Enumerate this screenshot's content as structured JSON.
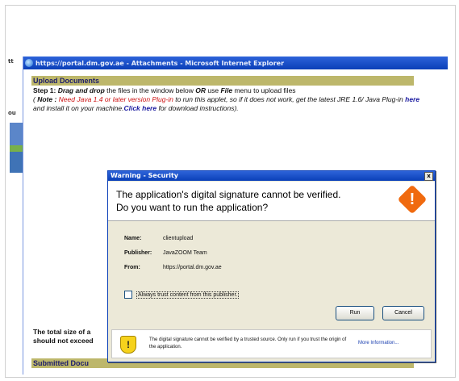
{
  "ie_window": {
    "title": "https://portal.dm.gov.ae - Attachments - Microsoft Internet Explorer"
  },
  "background_window": {
    "tab_fragment_1": "tt",
    "tab_fragment_2": "ou"
  },
  "page": {
    "upload_header": "Upload Documents",
    "step1_label": "Step 1:",
    "step1_drag": "Drag and drop",
    "step1_mid": " the files in the window below ",
    "step1_or": "OR",
    "step1_use": " use ",
    "step1_file": "File",
    "step1_end": " menu to upload files",
    "note_open": "( ",
    "note_label": "Note :",
    "note_red": " Need Java 1.4 or later version Plug-in",
    "note_mid": " to run this applet, so if it does not work, get the latest JRE 1.6/ Java Plug-in ",
    "link_here": "here",
    "note_install": " and install it on your machine.",
    "link_click_here": "Click here",
    "note_end": " for download instructions).",
    "total_size_line1": "The total size of a",
    "total_size_line2": "should not exceed",
    "submitted_header": "Submitted Docu"
  },
  "dialog": {
    "title": "Warning - Security",
    "close_glyph": "x",
    "question_line1": "The application's digital signature cannot be verified.",
    "question_line2": "Do you want to run the application?",
    "warning_glyph": "!",
    "name_label": "Name:",
    "name_value": "clientupload",
    "publisher_label": "Publisher:",
    "publisher_value": "JavaZOOM Team",
    "from_label": "From:",
    "from_value": "https://portal.dm.gov.ae",
    "always_trust_label": "Always trust content from this publisher.",
    "run_label": "Run",
    "cancel_label": "Cancel",
    "shield_glyph": "!",
    "footer_text": "The digital signature cannot be verified by a trusted source.  Only run if you trust the origin of the application.",
    "more_info_link": "More Information..."
  },
  "colors": {
    "header_bg": "#bdb76b",
    "title_bar": "#0a3fb8",
    "warning_orange": "#f06a0f",
    "note_red": "#cc1111"
  },
  "icons": [
    "ie-page-icon",
    "close-icon",
    "warning-icon",
    "shield-warning-icon"
  ]
}
